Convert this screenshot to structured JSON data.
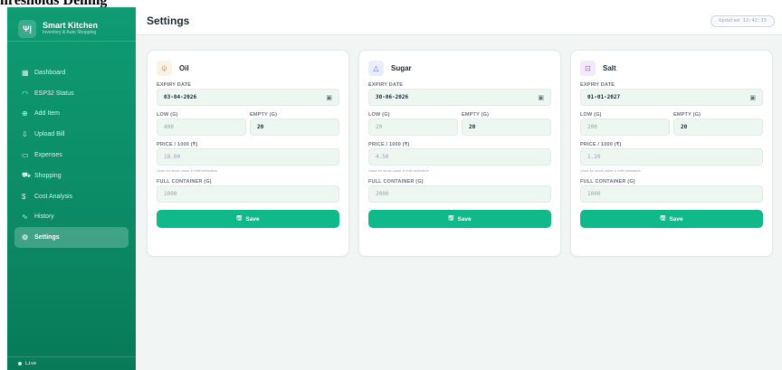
{
  "page_heading": "nresholds Demng",
  "brand": {
    "logo": "ΨĮ",
    "title": "Smart Kitchen",
    "subtitle": "Inventory & Auto Shopping"
  },
  "nav": [
    {
      "label": "Dashboard",
      "icon": "▦",
      "icon_name": "dashboard-icon"
    },
    {
      "label": "ESP32 Status",
      "icon": "◠",
      "icon_name": "wifi-icon"
    },
    {
      "label": "Add Item",
      "icon": "⊕",
      "icon_name": "add-circle-icon"
    },
    {
      "label": "Upload Bill",
      "icon": "⇩",
      "icon_name": "upload-icon"
    },
    {
      "label": "Expenses",
      "icon": "▭",
      "icon_name": "wallet-icon"
    },
    {
      "label": "Shopping",
      "icon": "⛟",
      "icon_name": "cart-icon"
    },
    {
      "label": "Cost Analysis",
      "icon": "$",
      "icon_name": "dollar-icon"
    },
    {
      "label": "History",
      "icon": "∿",
      "icon_name": "activity-icon"
    },
    {
      "label": "Settings",
      "icon": "⚙",
      "icon_name": "gear-icon"
    }
  ],
  "live_label": "Live",
  "header": {
    "title": "Settings",
    "updated": "Updated 12:42:33"
  },
  "labels": {
    "expiry": "EXPIRY DATE",
    "low": "LOW (G)",
    "empty": "EMPTY (G)",
    "price": "PRICE / 1000 (₹)",
    "hint": "Used for stock value & refill estimates",
    "full": "FULL CONTAINER (G)",
    "save": "Save"
  },
  "items": [
    {
      "name": "Oil",
      "icon": "ψ",
      "icon_bg": "#fdf2e3",
      "icon_color": "#f59e0b",
      "expiry": "03-04-2026",
      "low": "400",
      "empty": "20",
      "price": "18.00",
      "full": "1000"
    },
    {
      "name": "Sugar",
      "icon": "△",
      "icon_bg": "#e8eefc",
      "icon_color": "#6366f1",
      "expiry": "30-06-2026",
      "low": "20",
      "empty": "20",
      "price": "4.50",
      "full": "2000"
    },
    {
      "name": "Salt",
      "icon": "⊡",
      "icon_bg": "#f3e8fd",
      "icon_color": "#a855f7",
      "expiry": "01-01-2027",
      "low": "200",
      "empty": "20",
      "price": "1.20",
      "full": "1000"
    }
  ],
  "colors": {
    "accent": "#10b98a",
    "sidebar": "#0f9b73"
  }
}
